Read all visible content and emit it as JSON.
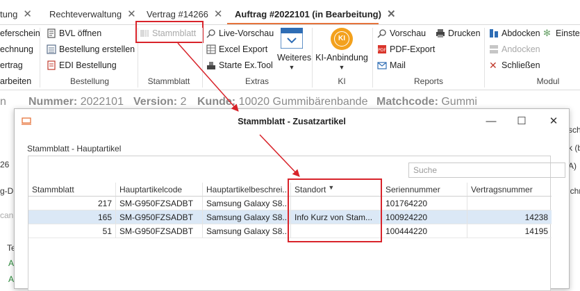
{
  "tabs": [
    {
      "label": "tung",
      "active": false
    },
    {
      "label": "Rechteverwaltung",
      "active": false
    },
    {
      "label": "Vertrag #14266",
      "active": false
    },
    {
      "label": "Auftrag #2022101 (in Bearbeitung)",
      "active": true
    }
  ],
  "ribbon": {
    "col0": [
      "eferschein",
      "echnung",
      "ertrag",
      "arbeiten"
    ],
    "bestellung": {
      "items": [
        "BVL öffnen",
        "Bestellung erstellen",
        "EDI Bestellung"
      ],
      "group": "Bestellung"
    },
    "stammblatt": {
      "item": "Stammblatt",
      "group": "Stammblatt"
    },
    "extras": {
      "items": [
        "Live-Vorschau",
        "Excel Export",
        "Starte Ex.Tool"
      ],
      "weiteres": "Weiteres",
      "group": "Extras"
    },
    "ki": {
      "item": "KI-Anbindung",
      "logo": "KI",
      "group": "KI"
    },
    "reports": {
      "items": [
        "Vorschau",
        "PDF-Export",
        "Mail"
      ],
      "drucken": "Drucken",
      "group": "Reports"
    },
    "modul": {
      "items": [
        "Abdocken",
        "Andocken",
        "Schließen"
      ],
      "einst": "Einste",
      "group": "Modul"
    }
  },
  "header": {
    "nummer_label": "Nummer:",
    "nummer": "2022101",
    "version_label": "Version:",
    "version": "2",
    "kunde_label": "Kunde:",
    "kunde": "10020 Gummibärenbande",
    "match_label": "Matchcode:",
    "match": "Gummi"
  },
  "background": {
    "left": [
      "26",
      "g-D",
      "cann",
      "Te",
      "A",
      "A"
    ],
    "right": [
      "sche",
      "k (b",
      "A)",
      "ichr"
    ]
  },
  "dialog": {
    "title": "Stammblatt - Zusatzartikel",
    "section": "Stammblatt - Hauptartikel",
    "search_placeholder": "Suche",
    "columns": [
      "Stammblatt",
      "Hauptartikelcode",
      "Hauptartikelbeschrei...",
      "Standort",
      "Seriennummer",
      "Vertragsnummer"
    ],
    "rows": [
      {
        "stammblatt": "217",
        "code": "SM-G950FZSADBT",
        "beschreibung": "Samsung Galaxy S8...",
        "standort": "",
        "serien": "101764220",
        "vertrag": ""
      },
      {
        "stammblatt": "165",
        "code": "SM-G950FZSADBT",
        "beschreibung": "Samsung Galaxy S8...",
        "standort": "Info Kurz von Stam...",
        "serien": "100924220",
        "vertrag": "14238"
      },
      {
        "stammblatt": "51",
        "code": "SM-G950FZSADBT",
        "beschreibung": "Samsung Galaxy S8...",
        "standort": "",
        "serien": "100444220",
        "vertrag": "14195"
      }
    ]
  },
  "colors": {
    "accent": "#e6733a",
    "highlight": "#d8232a",
    "selected": "#dbe8f6"
  }
}
